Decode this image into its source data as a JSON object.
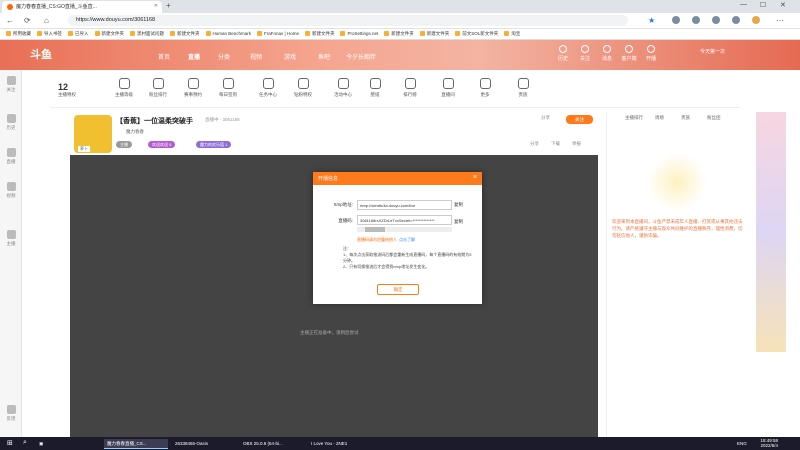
{
  "browser": {
    "tab_title": "魔力春春直播_CS:GO直播_斗鱼直...",
    "new_tab": "+",
    "url": "https://www.douyu.com/3061168",
    "bookmarks": [
      "所用收藏",
      "导入书签",
      "已导入",
      "新建文件夹",
      "黑村面试问题",
      "新建文件夹",
      "Human Benchmark",
      "FraFonax | Home",
      "新建文件夹",
      "ProSettings.net",
      "新建文件夹",
      "新建文件夹",
      "前文SOL新文件夹",
      "淘宝",
      "新建文件夹",
      "新建文件夹"
    ]
  },
  "site": {
    "logo": "斗鱼",
    "nav": [
      "首页",
      "直播",
      "分类",
      "视频",
      "游戏",
      "鱼吧",
      "今夕长相伴"
    ],
    "header_icons": [
      "历史",
      "关注",
      "消息",
      "客户端",
      "开播"
    ],
    "open_live": "今天第一次"
  },
  "categories": {
    "count": "12",
    "items": [
      "主播特权",
      "主播等级",
      "粉丝排行",
      "赛事预约",
      "每日签到",
      "任务中心",
      "钻粉特权",
      "活动中心",
      "壁纸",
      "排行榜",
      "直播间",
      "更多",
      "贵族"
    ]
  },
  "sidebar": [
    "关注",
    "历史",
    "直播",
    "视频",
    "主播",
    "反馈"
  ],
  "room": {
    "title": "【香蕉】一位温柔突破手",
    "subtitle": "直播中 · 3061168",
    "host": "魔力春春",
    "avatar_tag": "萝卜",
    "pills": [
      "主播",
      "欢迎欢迎 5",
      "魔力的欢乐值 1"
    ],
    "follow": "关注",
    "share": "分享",
    "actions": [
      "分享",
      "下载",
      "举报",
      "客户端"
    ]
  },
  "player": {
    "message": "主播正在准备中，请稍后尝试"
  },
  "modal": {
    "title": "开播信息",
    "rtmp_label": "rtmp地址:",
    "rtmp_value": "rtmp://sendtc3a.douyu.com/live",
    "code_label": "直播码:",
    "code_value": "3061168rsXZDrLeTxxSecret=**************",
    "copy1": "复制",
    "copy2": "复制",
    "warning": "直播码请勿泄露给他人",
    "help": "点击了解",
    "note_title": "注：",
    "notes": [
      "1、每次点击获取推流码后都会重新生成直播码，每个直播码的有效期为5分钟。",
      "2、只有切换推流后才会得到rtmp地址发生变化。"
    ],
    "ok": "确定"
  },
  "chat": {
    "tabs": [
      "主播排行",
      "周榜",
      "贵族",
      "粉丝团"
    ],
    "notice": "欢迎来到本直播间，斗鱼严禁未成年人直播、打赏或从事其他违法行为。请严格遵守主播与观众共同维护的直播秩序，理性消费，切勿轻信他人，谨防诈骗。"
  },
  "taskbar": {
    "items": [
      "魔力春春直播_CS...",
      "26338465-Oasis",
      "OBS 25.0.8 (64-bi...",
      "I Love You - 2NE1"
    ],
    "time": "18:49:58",
    "date": "2022/6/4",
    "lang": "ENG"
  },
  "colors": {
    "accent": "#ff7a1a",
    "banner": "#e86f55",
    "player": "#444444",
    "taskbar": "#1b1b2b"
  }
}
